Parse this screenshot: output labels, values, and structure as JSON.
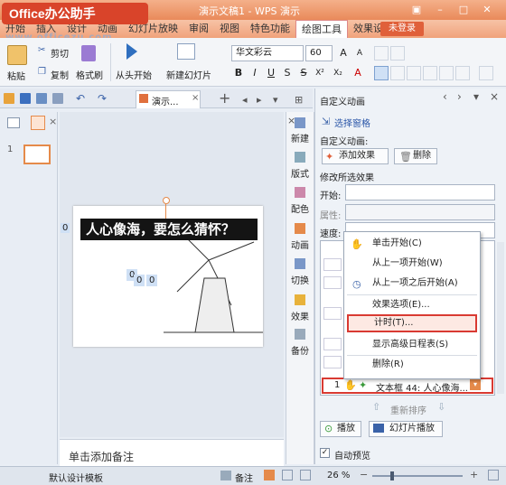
{
  "window": {
    "logo_text": "Office办公助手",
    "title": "演示文稿1 - WPS 演示",
    "watermark_url": "www.officezu.com",
    "controls": [
      "▣",
      "–",
      "□",
      "✕"
    ]
  },
  "menu": {
    "items": [
      "开始",
      "插入",
      "设计",
      "动画",
      "幻灯片放映",
      "审阅",
      "视图",
      "特色功能",
      "绘图工具",
      "效果设置"
    ],
    "active": "绘图工具",
    "login": "未登录"
  },
  "ribbon": {
    "paste": "粘贴",
    "cut": "剪切",
    "copy": "复制",
    "format_painter": "格式刷",
    "from_start": "从头开始",
    "new_slide": "新建幻灯片",
    "font_name": "华文彩云",
    "font_size": "60"
  },
  "tabs": {
    "doc_tab": "演示...",
    "plus": "+"
  },
  "thumbs": {
    "slide_number": "1"
  },
  "slide": {
    "title_text": "人心像海，要怎么猜怀？",
    "anim_tags": [
      "0",
      "0",
      "0",
      "0"
    ],
    "notes_placeholder": "单击添加备注"
  },
  "sidebar": {
    "items": [
      "新建",
      "版式",
      "配色",
      "动画",
      "切换",
      "效果",
      "备份"
    ]
  },
  "pane": {
    "title": "自定义动画",
    "select_pane": "选择窗格",
    "section_custom": "自定义动画:",
    "add_effect": "添加效果",
    "delete": "删除",
    "modify_label": "修改所选效果",
    "start_label": "开始:",
    "property_label": "属性:",
    "speed_label": "速度:",
    "list_item": "1",
    "list_item_text": "文本框 44: 人心像海...",
    "reorder": "重新排序",
    "play": "播放",
    "slideshow": "幻灯片播放",
    "autopreview": "自动预览"
  },
  "context_menu": {
    "items": [
      {
        "label": "单击开始(C)",
        "icon": "mouse-icon"
      },
      {
        "label": "从上一项开始(W)",
        "icon": ""
      },
      {
        "label": "从上一项之后开始(A)",
        "icon": "clock-icon"
      },
      {
        "label": "效果选项(E)...",
        "icon": ""
      },
      {
        "label": "计时(T)...",
        "icon": ""
      },
      {
        "label": "显示高级日程表(S)",
        "icon": ""
      },
      {
        "label": "删除(R)",
        "icon": ""
      }
    ],
    "highlighted": "计时(T)..."
  },
  "status": {
    "template": "默认设计模板",
    "notes": "备注",
    "zoom": "26 %"
  },
  "colors": {
    "title_bar": "#e98a5a",
    "accent": "#e0603a",
    "highlight_border": "#d93a32"
  }
}
